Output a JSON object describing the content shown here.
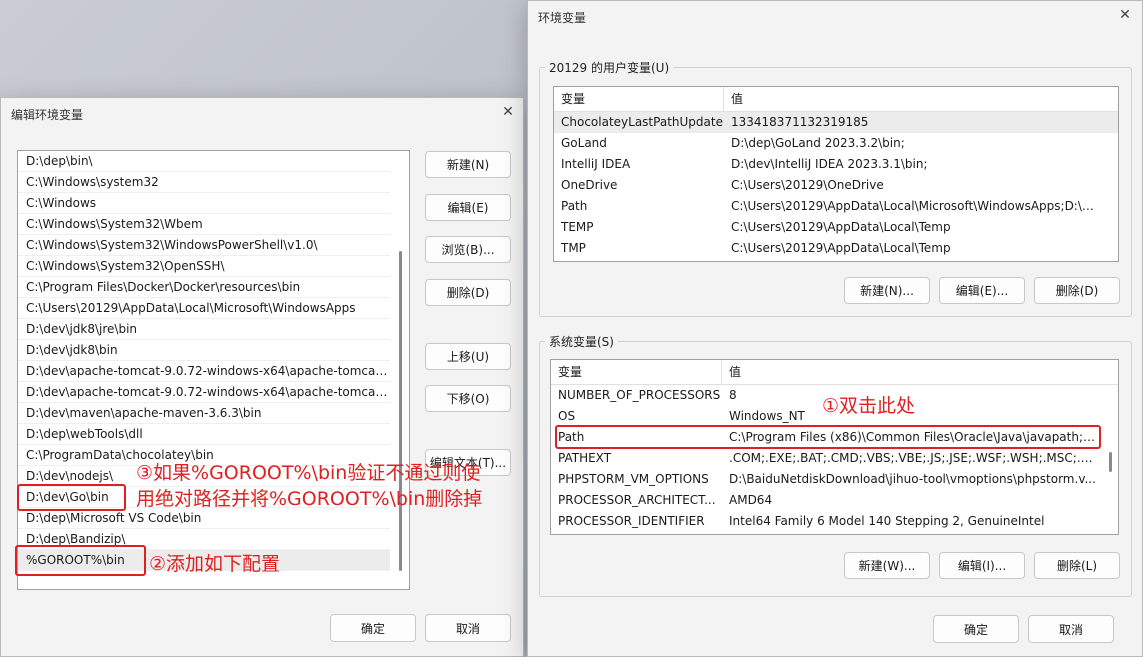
{
  "edit_dialog": {
    "title": "编辑环境变量",
    "close": "✕",
    "path_items": [
      "D:\\dep\\bin\\",
      "C:\\Windows\\system32",
      "C:\\Windows",
      "C:\\Windows\\System32\\Wbem",
      "C:\\Windows\\System32\\WindowsPowerShell\\v1.0\\",
      "C:\\Windows\\System32\\OpenSSH\\",
      "C:\\Program Files\\Docker\\Docker\\resources\\bin",
      "C:\\Users\\20129\\AppData\\Local\\Microsoft\\WindowsApps",
      "D:\\dev\\jdk8\\jre\\bin",
      "D:\\dev\\jdk8\\bin",
      "D:\\dev\\apache-tomcat-9.0.72-windows-x64\\apache-tomcat-9...",
      "D:\\dev\\apache-tomcat-9.0.72-windows-x64\\apache-tomcat-9...",
      "D:\\dev\\maven\\apache-maven-3.6.3\\bin",
      "D:\\dep\\webTools\\dll",
      "C:\\ProgramData\\chocolatey\\bin",
      "D:\\dev\\nodejs\\",
      "D:\\dev\\Go\\bin",
      "D:\\dep\\Microsoft VS Code\\bin",
      "D:\\dep\\Bandizip\\",
      "%GOROOT%\\bin"
    ],
    "buttons": {
      "new": "新建(N)",
      "edit": "编辑(E)",
      "browse": "浏览(B)...",
      "delete": "删除(D)",
      "move_up": "上移(U)",
      "move_down": "下移(O)",
      "edit_text": "编辑文本(T)...",
      "ok": "确定",
      "cancel": "取消"
    }
  },
  "env_window": {
    "title": "环境变量",
    "close": "✕",
    "user_group_label": "20129 的用户变量(U)",
    "system_group_label": "系统变量(S)",
    "col_name": "变量",
    "col_value": "值",
    "user_vars": [
      {
        "name": "ChocolateyLastPathUpdate",
        "value": "133418371132319185"
      },
      {
        "name": "GoLand",
        "value": "D:\\dep\\GoLand 2023.3.2\\bin;"
      },
      {
        "name": "IntelliJ IDEA",
        "value": "D:\\dev\\IntelliJ IDEA 2023.3.1\\bin;"
      },
      {
        "name": "OneDrive",
        "value": "C:\\Users\\20129\\OneDrive"
      },
      {
        "name": "Path",
        "value": "C:\\Users\\20129\\AppData\\Local\\Microsoft\\WindowsApps;D:\\d..."
      },
      {
        "name": "TEMP",
        "value": "C:\\Users\\20129\\AppData\\Local\\Temp"
      },
      {
        "name": "TMP",
        "value": "C:\\Users\\20129\\AppData\\Local\\Temp"
      }
    ],
    "system_vars": [
      {
        "name": "NUMBER_OF_PROCESSORS",
        "value": "8"
      },
      {
        "name": "OS",
        "value": "Windows_NT"
      },
      {
        "name": "Path",
        "value": "C:\\Program Files (x86)\\Common Files\\Oracle\\Java\\javapath;C:..."
      },
      {
        "name": "PATHEXT",
        "value": ".COM;.EXE;.BAT;.CMD;.VBS;.VBE;.JS;.JSE;.WSF;.WSH;.MSC;.PY;.P..."
      },
      {
        "name": "PHPSTORM_VM_OPTIONS",
        "value": "D:\\BaiduNetdiskDownload\\jihuo-tool\\vmoptions\\phpstorm.v..."
      },
      {
        "name": "PROCESSOR_ARCHITECT...",
        "value": "AMD64"
      },
      {
        "name": "PROCESSOR_IDENTIFIER",
        "value": "Intel64 Family 6 Model 140 Stepping 2, GenuineIntel"
      }
    ],
    "user_buttons": {
      "new": "新建(N)...",
      "edit": "编辑(E)...",
      "delete": "删除(D)"
    },
    "system_buttons": {
      "new": "新建(W)...",
      "edit": "编辑(I)...",
      "delete": "删除(L)"
    },
    "ok": "确定",
    "cancel": "取消"
  },
  "annotations": {
    "step1": "①双击此处",
    "step2": "②添加如下配置",
    "step3_line1": "③如果%GOROOT%\\bin验证不通过则使",
    "step3_line2": "用绝对路径并将%GOROOT%\\bin删除掉"
  },
  "colors": {
    "annotation_red": "#e02020"
  }
}
